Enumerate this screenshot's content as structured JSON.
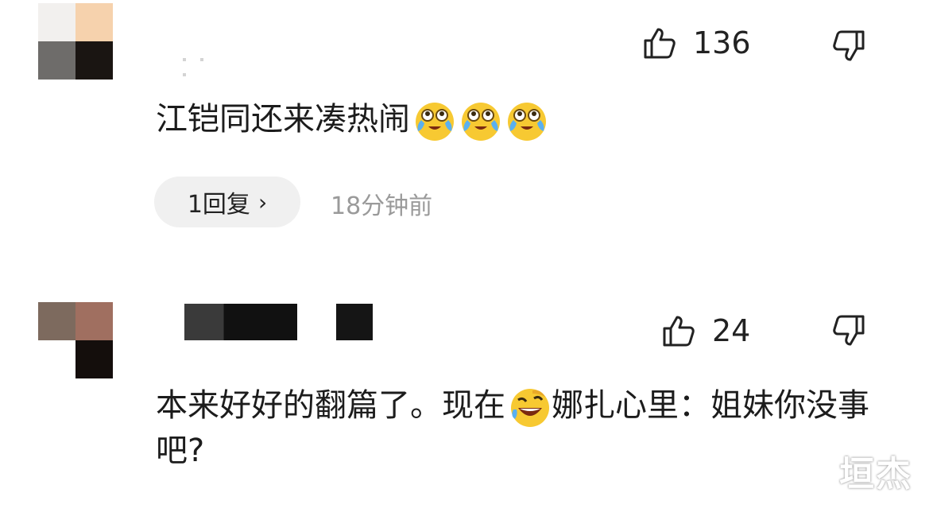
{
  "comments": [
    {
      "likes": "136",
      "text": "江铠同还来凑热闹",
      "emoji_count": 3,
      "reply_label": "1回复",
      "time": "18分钟前"
    },
    {
      "likes": "24",
      "text_before_emoji": "本来好好的翻篇了。现在",
      "text_after_emoji": "娜扎心里：姐妹你没事吧?"
    }
  ],
  "watermark": "垣杰",
  "icons": {
    "like": "thumbs-up-icon",
    "dislike": "thumbs-down-icon",
    "chevron": "chevron-right-icon",
    "emoji_cry": "tears-of-joy-emoji",
    "emoji_laugh": "rolling-laugh-emoji"
  },
  "colors": {
    "time_gray": "#9a9a9a",
    "pill_bg": "#f0f0f0",
    "emoji_yellow": "#f7c932"
  }
}
